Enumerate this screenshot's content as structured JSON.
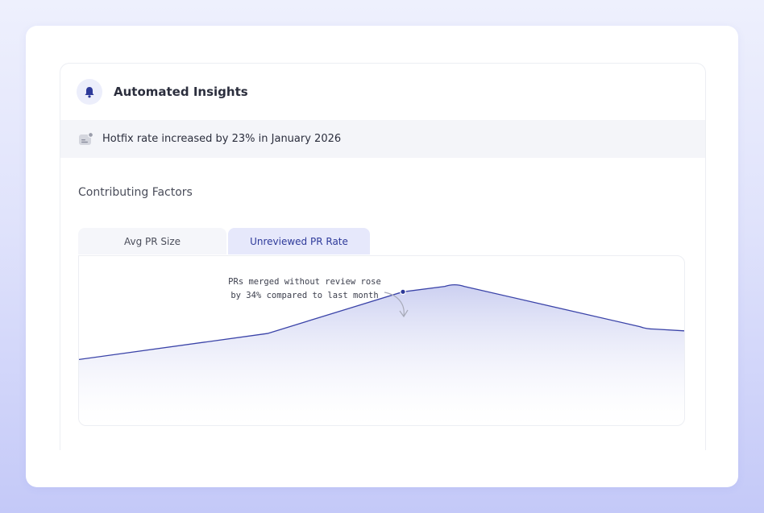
{
  "panel": {
    "title": "Automated Insights",
    "icon": "bell-icon",
    "accent_color": "#2e3a9a"
  },
  "insight": {
    "text": "Hotfix rate increased by 23% in January 2026",
    "icon": "notification-card-icon"
  },
  "factors": {
    "title": "Contributing Factors",
    "tabs": [
      {
        "label": "Avg PR Size",
        "active": false
      },
      {
        "label": "Unreviewed PR Rate",
        "active": true
      }
    ]
  },
  "annotation": {
    "line1": "PRs merged without review rose",
    "line2": "by 34% compared to last month"
  },
  "chart_data": {
    "type": "area",
    "x": [
      0,
      1,
      2,
      3,
      4
    ],
    "values": [
      0.35,
      0.55,
      0.93,
      0.59,
      0.57
    ],
    "highlight_index": 2,
    "grid": false,
    "line_color": "#3a43a8",
    "fill_color": "#dcdff5"
  }
}
